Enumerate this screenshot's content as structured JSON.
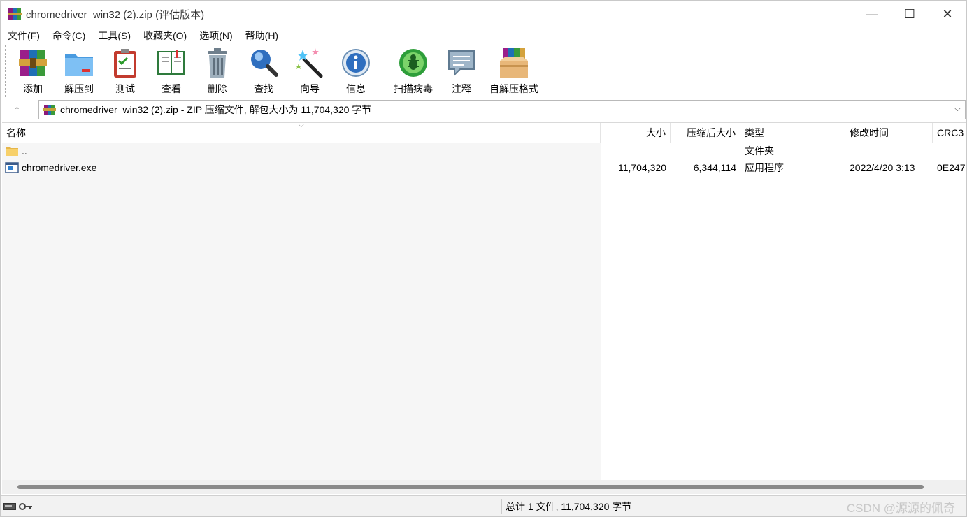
{
  "window": {
    "title": "chromedriver_win32 (2).zip (评估版本)",
    "controls": {
      "minimize": "—",
      "maximize": "☐",
      "close": "✕"
    }
  },
  "menu": [
    "文件(F)",
    "命令(C)",
    "工具(S)",
    "收藏夹(O)",
    "选项(N)",
    "帮助(H)"
  ],
  "toolbar": [
    {
      "label": "添加",
      "icon": "add-archive-icon"
    },
    {
      "label": "解压到",
      "icon": "extract-to-folder-icon"
    },
    {
      "label": "测试",
      "icon": "test-clipboard-icon"
    },
    {
      "label": "查看",
      "icon": "view-book-icon"
    },
    {
      "label": "删除",
      "icon": "trash-can-icon"
    },
    {
      "label": "查找",
      "icon": "magnifier-icon"
    },
    {
      "label": "向导",
      "icon": "magic-wand-icon"
    },
    {
      "label": "信息",
      "icon": "info-icon"
    },
    {
      "label": "扫描病毒",
      "icon": "virus-scan-icon"
    },
    {
      "label": "注释",
      "icon": "comment-icon"
    },
    {
      "label": "自解压格式",
      "icon": "sfx-box-icon"
    }
  ],
  "address": {
    "up_icon": "↑",
    "text": "chromedriver_win32 (2).zip - ZIP 压缩文件, 解包大小为 11,704,320 字节",
    "dropdown_icon": "⌵"
  },
  "columns": {
    "name": "名称",
    "size": "大小",
    "packed": "压缩后大小",
    "type": "类型",
    "modified": "修改时间",
    "crc": "CRC3"
  },
  "files": [
    {
      "name": "..",
      "size": "",
      "packed": "",
      "type": "文件夹",
      "modified": "",
      "crc": "",
      "icon": "folder-icon"
    },
    {
      "name": "chromedriver.exe",
      "size": "11,704,320",
      "packed": "6,344,114",
      "type": "应用程序",
      "modified": "2022/4/20 3:13",
      "crc": "0E247",
      "icon": "exe-file-icon"
    }
  ],
  "status": {
    "summary": "总计 1 文件, 11,704,320 字节",
    "watermark": "CSDN @源源的佩奇"
  },
  "colors": {
    "name_column_bg": "#f6f6f6",
    "scroll_thumb": "#8a8a8a",
    "watermark": "#c8c8c8"
  }
}
